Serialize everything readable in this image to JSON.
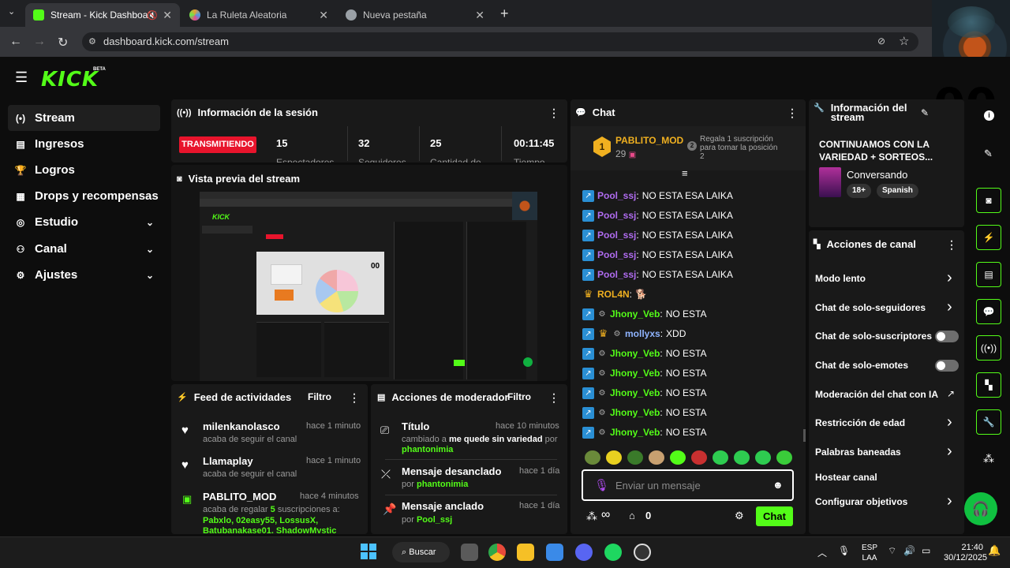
{
  "browser": {
    "tabs": [
      {
        "label": "Stream - Kick Dashboard",
        "fav_color": "#53fc18"
      },
      {
        "label": "La Ruleta Aleatoria",
        "fav_color": "#e8a030"
      },
      {
        "label": "Nueva pestaña",
        "fav_color": "#9aa0a6"
      }
    ],
    "url": "dashboard.kick.com/stream"
  },
  "brand": {
    "logo": "KICK",
    "beta": "BETA",
    "accent": "#53fc18"
  },
  "sidebar": {
    "items": [
      {
        "label": "Stream",
        "icon": "broadcast-icon",
        "glyph": "(•)"
      },
      {
        "label": "Ingresos",
        "icon": "chart-icon",
        "glyph": "▤"
      },
      {
        "label": "Logros",
        "icon": "trophy-icon",
        "glyph": "🏆"
      },
      {
        "label": "Drops y recompensas",
        "icon": "gift-icon",
        "glyph": "▦"
      },
      {
        "label": "Estudio",
        "icon": "studio-icon",
        "glyph": "◎"
      },
      {
        "label": "Canal",
        "icon": "users-icon",
        "glyph": "⚇"
      },
      {
        "label": "Ajustes",
        "icon": "gear-icon",
        "glyph": "⚙"
      }
    ]
  },
  "session": {
    "title": "Información de la sesión",
    "status": "TRANSMITIENDO",
    "stats": [
      {
        "value": "15",
        "label": "Espectadores"
      },
      {
        "value": "32",
        "label": "Seguidores"
      },
      {
        "value": "25",
        "label": "Cantidad de"
      },
      {
        "value": "00:11:45",
        "label": "Tiempo"
      }
    ]
  },
  "preview": {
    "title": "Vista previa del stream"
  },
  "feed": {
    "title": "Feed de actividades",
    "filter": "Filtro",
    "items": [
      {
        "user": "milenkanolasco",
        "time": "hace 1 minuto",
        "desc": "acaba de seguir el canal"
      },
      {
        "user": "Llamaplay",
        "time": "hace 1 minuto",
        "desc": "acaba de seguir el canal"
      },
      {
        "user": "PABLITO_MOD",
        "time": "hace 4 minutos",
        "desc_pre": "acaba de regalar",
        "desc_num": "5",
        "desc_post": "suscripciones a:",
        "recipients": "Pabxlo, 02easy55, LossusX,",
        "recipients2": "Batubanakase01, ShadowMystic"
      }
    ]
  },
  "modactions": {
    "title": "Acciones de moderador",
    "filter": "Filtro",
    "items": [
      {
        "title": "Título",
        "time": "hace 10 minutos",
        "desc_pre": "cambiado a",
        "desc_bold": "me quede sin variedad",
        "desc_mid": "por",
        "by": "phantonimia"
      },
      {
        "title": "Mensaje desanclado",
        "time": "hace 1 día",
        "desc_mid": "por",
        "by": "phantonimia"
      },
      {
        "title": "Mensaje anclado",
        "time": "hace 1 día",
        "desc_mid": "por",
        "by": "Pool_ssj"
      }
    ]
  },
  "chat": {
    "title": "Chat",
    "top_gifter": {
      "rank": "1",
      "name": "PABLITO_MOD",
      "count": "29",
      "promo_rank": "2",
      "promo": "Regala 1 suscripción para tomar la posición 2"
    },
    "messages": [
      {
        "user": "Pool_ssj",
        "color": "#b06cf0",
        "badges": [
          "blue"
        ],
        "text": "NO ESTA ESA LAIKA"
      },
      {
        "user": "Pool_ssj",
        "color": "#b06cf0",
        "badges": [
          "blue"
        ],
        "text": "NO ESTA ESA LAIKA"
      },
      {
        "user": "Pool_ssj",
        "color": "#b06cf0",
        "badges": [
          "blue"
        ],
        "text": "NO ESTA ESA LAIKA"
      },
      {
        "user": "Pool_ssj",
        "color": "#b06cf0",
        "badges": [
          "blue"
        ],
        "text": "NO ESTA ESA LAIKA"
      },
      {
        "user": "Pool_ssj",
        "color": "#b06cf0",
        "badges": [
          "blue"
        ],
        "text": "NO ESTA ESA LAIKA"
      },
      {
        "user": "ROL4N",
        "color": "#f0b020",
        "badges": [
          "gold"
        ],
        "text": "🐕"
      },
      {
        "user": "Jhony_Veb",
        "color": "#53fc18",
        "badges": [
          "blue",
          "gray"
        ],
        "text": "NO ESTA"
      },
      {
        "user": "mollyxs",
        "color": "#8fb4ff",
        "badges": [
          "blue",
          "gold",
          "gray"
        ],
        "text": "XDD"
      },
      {
        "user": "Jhony_Veb",
        "color": "#53fc18",
        "badges": [
          "blue",
          "gray"
        ],
        "text": "NO ESTA"
      },
      {
        "user": "Jhony_Veb",
        "color": "#53fc18",
        "badges": [
          "blue",
          "gray"
        ],
        "text": "NO ESTA"
      },
      {
        "user": "Jhony_Veb",
        "color": "#53fc18",
        "badges": [
          "blue",
          "gray"
        ],
        "text": "NO ESTA"
      },
      {
        "user": "Jhony_Veb",
        "color": "#53fc18",
        "badges": [
          "blue",
          "gray"
        ],
        "text": "NO ESTA"
      },
      {
        "user": "Jhony_Veb",
        "color": "#53fc18",
        "badges": [
          "blue",
          "gray"
        ],
        "text": "NO ESTA"
      }
    ],
    "placeholder": "Enviar un mensaje",
    "infinity": "∞",
    "points": "0",
    "send": "Chat"
  },
  "streaminfo": {
    "title": "Información del stream",
    "stream_title": "CONTINUAMOS CON LA VARIEDAD + SORTEOS...",
    "category": "Conversando",
    "tags": [
      "18+",
      "Spanish"
    ]
  },
  "channelactions": {
    "title": "Acciones de canal",
    "items": [
      {
        "label": "Modo lento",
        "kind": "chevron"
      },
      {
        "label": "Chat de solo-seguidores",
        "kind": "chevron"
      },
      {
        "label": "Chat de solo-suscriptores",
        "kind": "toggle"
      },
      {
        "label": "Chat de solo-emotes",
        "kind": "toggle"
      },
      {
        "label": "Moderación del chat con IA",
        "kind": "external"
      },
      {
        "label": "Restricción de edad",
        "kind": "chevron"
      },
      {
        "label": "Palabras baneadas",
        "kind": "chevron"
      },
      {
        "label": "Hostear canal",
        "kind": "none"
      },
      {
        "label": "Configurar objetivos",
        "kind": "chevron"
      }
    ]
  },
  "overlay_text": "00",
  "taskbar": {
    "search": "Buscar",
    "lang1": "ESP",
    "lang2": "LAA",
    "time": "21:40",
    "date": "30/12/2025"
  }
}
